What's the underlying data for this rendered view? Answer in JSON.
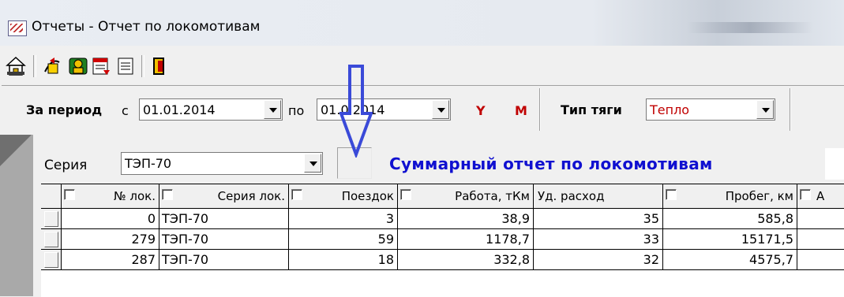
{
  "window": {
    "title": "Отчеты - Отчет по локомотивам"
  },
  "toolbar": {
    "icons": [
      "home-icon",
      "export-icon",
      "person-icon",
      "report-icon",
      "document-icon",
      "exit-door-icon"
    ]
  },
  "period": {
    "label_bold": "За период",
    "from_label": "с",
    "from_value": "01.01.2014",
    "to_label": "по",
    "to_value": "01.0 2014",
    "y_label": "Y",
    "m_label": "M"
  },
  "traction": {
    "label": "Тип тяги",
    "value": "Тепло"
  },
  "series": {
    "label": "Серия",
    "value": "ТЭП-70"
  },
  "report_heading": "Суммарный отчет по локомотивам",
  "table": {
    "columns": [
      "№ лок.",
      "Серия лок.",
      "Поездок",
      "Работа, тКм",
      "Уд. расход",
      "Пробег, км",
      "А"
    ],
    "rows": [
      [
        "0",
        "ТЭП-70",
        "3",
        "38,9",
        "35",
        "585,8",
        ""
      ],
      [
        "279",
        "ТЭП-70",
        "59",
        "1178,7",
        "33",
        "15171,5",
        ""
      ],
      [
        "287",
        "ТЭП-70",
        "18",
        "332,8",
        "32",
        "4575,7",
        ""
      ]
    ]
  },
  "colors": {
    "heading": "#1010d0",
    "ym": "#c00000",
    "arrow": "#3a4ad8"
  }
}
